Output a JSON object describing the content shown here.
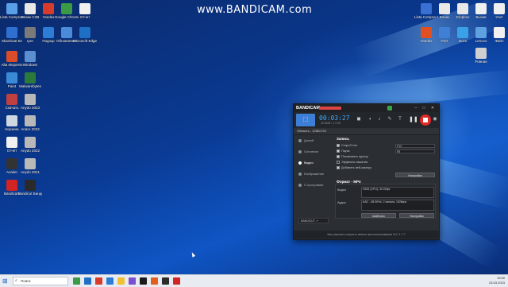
{
  "watermark": "www.BANDICAM.com",
  "desktop_icons_left": [
    {
      "label": "Lista Compra Sejuru",
      "color": "#5aa0e8"
    },
    {
      "label": "Бланк СЗВ",
      "color": "#e8e8e8"
    },
    {
      "label": "Yandex",
      "color": "#d93b2b"
    },
    {
      "label": "Google Chrome",
      "color": "#3a9a45"
    },
    {
      "label": "Отчет",
      "color": "#f0f0f0"
    },
    {
      "label": "Skachivat Bz",
      "color": "#2f6fd0"
    },
    {
      "label": "Ipre",
      "color": "#7a7a7a"
    },
    {
      "label": "Подозр",
      "color": "#2d7cd6"
    },
    {
      "label": "Обновление",
      "color": "#4c8bd9"
    },
    {
      "label": "Microsoft Edge",
      "color": "#1f6fc4"
    },
    {
      "label": "Alta ekspress",
      "color": "#d94d2b"
    },
    {
      "label": "Windows",
      "color": "#5b8fd0"
    },
    {
      "label": "Paint",
      "color": "#3b8ad8"
    },
    {
      "label": "Malwarebytes",
      "color": "#2b7a3c"
    },
    {
      "label": "Скачать",
      "color": "#c04040"
    },
    {
      "label": "Anydo 2023",
      "color": "#b8b8b8"
    },
    {
      "label": "Корзина",
      "color": "#cfd8e0"
    },
    {
      "label": "Anaro 2023",
      "color": "#b8b8b8"
    },
    {
      "label": "Отчёт",
      "color": "#f0f0f0"
    },
    {
      "label": "Anydo 2022",
      "color": "#b8b8b8"
    },
    {
      "label": "Avaker",
      "color": "#333333"
    },
    {
      "label": "Anydo 2021",
      "color": "#b8b8b8"
    },
    {
      "label": "Bandicam",
      "color": "#d32424"
    },
    {
      "label": "Bandicut Бандикат",
      "color": "#2a2a2a"
    }
  ],
  "desktop_icons_right": [
    {
      "label": "Lista Compra Oxiblanc",
      "color": "#3a6fd4"
    },
    {
      "label": "Бланк",
      "color": "#e8e8e8"
    },
    {
      "label": "Dropbox",
      "color": "#e8e8e8"
    },
    {
      "label": "Вызов",
      "color": "#f0f0f0"
    },
    {
      "label": "Учет",
      "color": "#f0f0f0"
    },
    {
      "label": "Yandex",
      "color": "#e05020"
    },
    {
      "label": "Учет",
      "color": "#3f7fd6"
    },
    {
      "label": "Docs",
      "color": "#3aa0e8"
    },
    {
      "label": "Lenovo",
      "color": "#5fa0e0"
    },
    {
      "label": "Файл",
      "color": "#f0f0f0"
    },
    {
      "label": "Ровная",
      "color": "#d0d0d0"
    }
  ],
  "bandicam": {
    "title": "BANDICAM",
    "timer": "00:03:27",
    "size": "25.6MB / 1.7GB",
    "mode_label": "Область - 1280x720",
    "sidebar": [
      {
        "label": "Домой",
        "active": false
      },
      {
        "label": "Основное",
        "active": false
      },
      {
        "label": "Видео",
        "active": true
      },
      {
        "label": "Изображение",
        "active": false
      },
      {
        "label": "О программе",
        "active": false
      }
    ],
    "badge": "BANDICUT ↗",
    "record_title": "Запись",
    "options": [
      {
        "label": "Старт/Стоп",
        "checked": true,
        "field": "F12"
      },
      {
        "label": "Пауза",
        "checked": true,
        "field": "F8"
      },
      {
        "label": "Показывать курсор",
        "checked": true,
        "field": ""
      },
      {
        "label": "Эффекты нажатия",
        "checked": false,
        "field": ""
      },
      {
        "label": "Добавить веб-камеру",
        "checked": true,
        "field": ""
      }
    ],
    "settings_button": "Настройки",
    "format_title": "Формат - MP4",
    "video_label": "Видео",
    "video_value": "H264 (CPU), 30.00fps",
    "audio_label": "Аудио",
    "audio_value": "AAC - 48.0KHz, 2 канала, 192kbps",
    "presets_button": "Шаблоны",
    "settings_button2": "Настройки",
    "status": "Как улучшить скорость записи при использовании VLC 1.7.7"
  },
  "taskbar": {
    "search_placeholder": "Поиск",
    "time": "19:50",
    "date": "23.03.2023",
    "pinned_colors": [
      "#3a9a45",
      "#1f6fc4",
      "#d93b2b",
      "#2d7cd6",
      "#f0c030",
      "#7a4fd0",
      "#1a1a1a",
      "#e06020",
      "#2b2b2b",
      "#d32424"
    ]
  }
}
